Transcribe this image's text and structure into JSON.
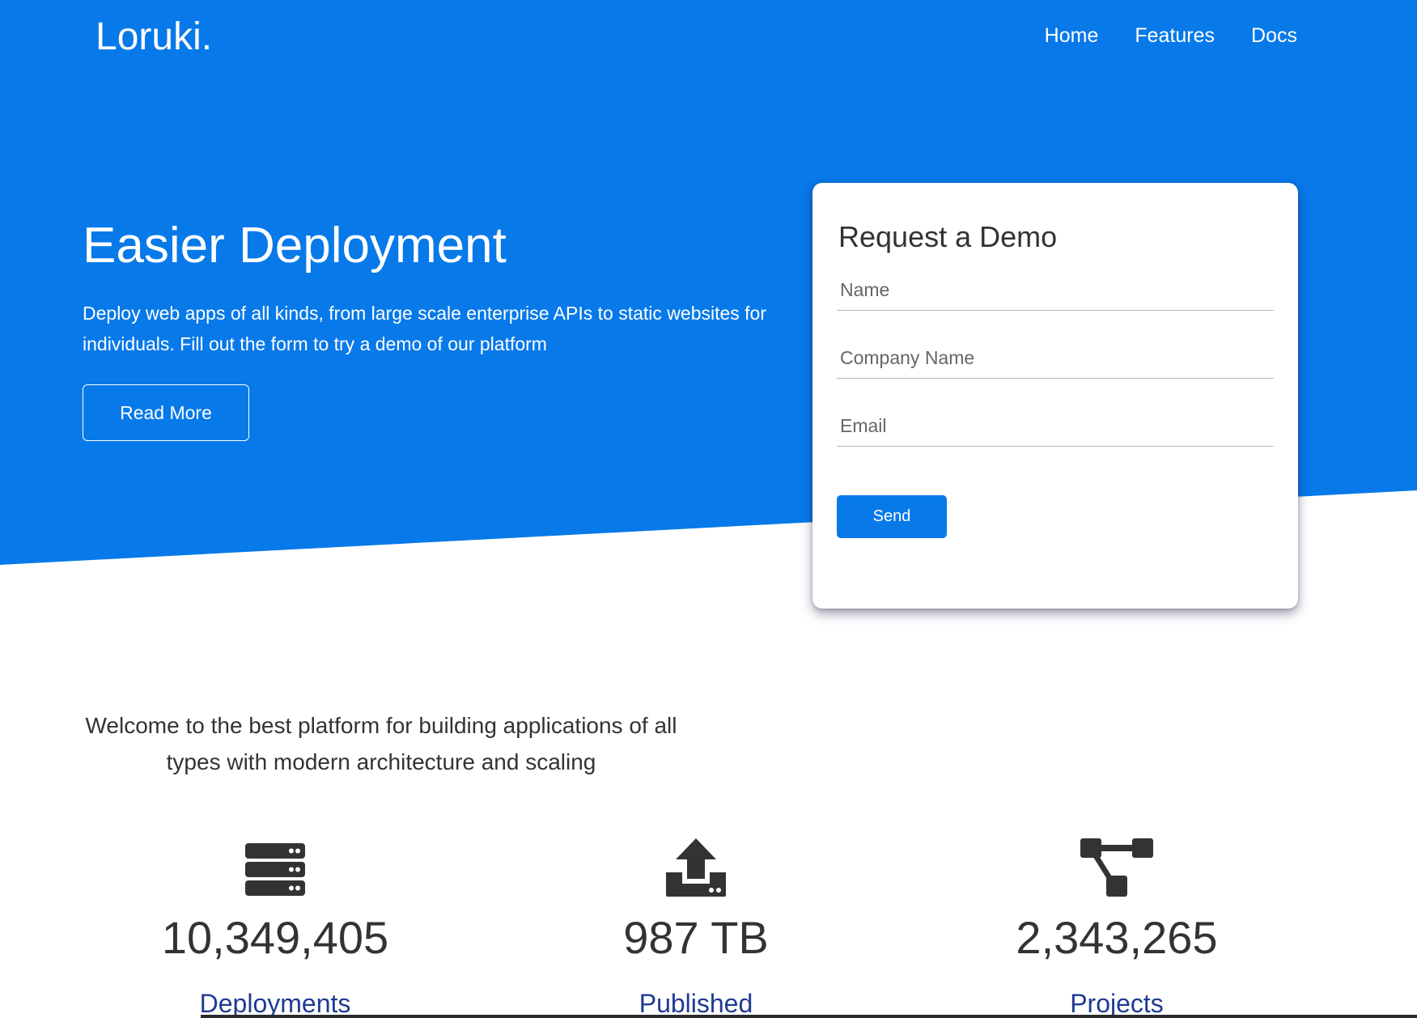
{
  "brand": {
    "logo": "Loruki."
  },
  "nav": {
    "items": [
      "Home",
      "Features",
      "Docs"
    ]
  },
  "hero": {
    "title": "Easier Deployment",
    "description": "Deploy web apps of all kinds, from large scale enterprise APIs to static websites for individuals. Fill out the form to try a demo of our platform",
    "read_more": "Read More"
  },
  "demo_form": {
    "title": "Request a Demo",
    "name_placeholder": "Name",
    "company_placeholder": "Company Name",
    "email_placeholder": "Email",
    "send_label": "Send"
  },
  "welcome": {
    "text": "Welcome to the best platform for building applications of all types with modern architecture and scaling"
  },
  "stats": [
    {
      "icon": "server-icon",
      "value": "10,349,405",
      "label": "Deployments"
    },
    {
      "icon": "upload-icon",
      "value": "987 TB",
      "label": "Published"
    },
    {
      "icon": "project-diagram-icon",
      "value": "2,343,265",
      "label": "Projects"
    }
  ],
  "colors": {
    "primary": "#0779e9",
    "label": "#1f3a93",
    "text": "#333333"
  }
}
